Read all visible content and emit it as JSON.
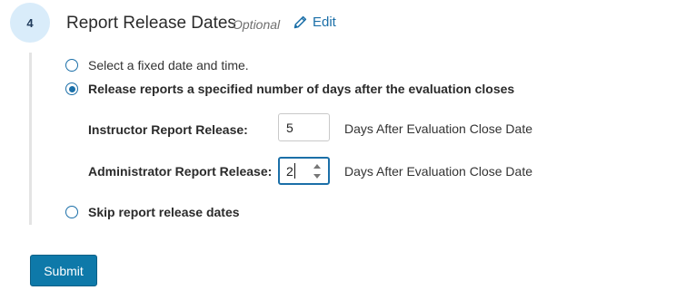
{
  "step": {
    "number": "4",
    "title": "Report Release Dates",
    "optional_label": "Optional",
    "edit_label": "Edit"
  },
  "options": [
    {
      "label": "Select a fixed date and time.",
      "selected": false
    },
    {
      "label": "Release reports a specified number of days after the evaluation closes",
      "selected": true
    },
    {
      "label": "Skip report release dates",
      "selected": false
    }
  ],
  "fields": {
    "instructor": {
      "label": "Instructor Report Release:",
      "value": "5",
      "suffix": "Days After Evaluation Close Date"
    },
    "administrator": {
      "label": "Administrator Report Release:",
      "value": "2",
      "suffix": "Days After Evaluation Close Date"
    }
  },
  "submit_label": "Submit",
  "icons": {
    "edit": "pencil-icon",
    "stepper_up": "chevron-up-icon",
    "stepper_down": "chevron-down-icon"
  },
  "colors": {
    "accent": "#1b6fa8",
    "button": "#0e79a9",
    "step_circle": "#d9ecfa"
  }
}
